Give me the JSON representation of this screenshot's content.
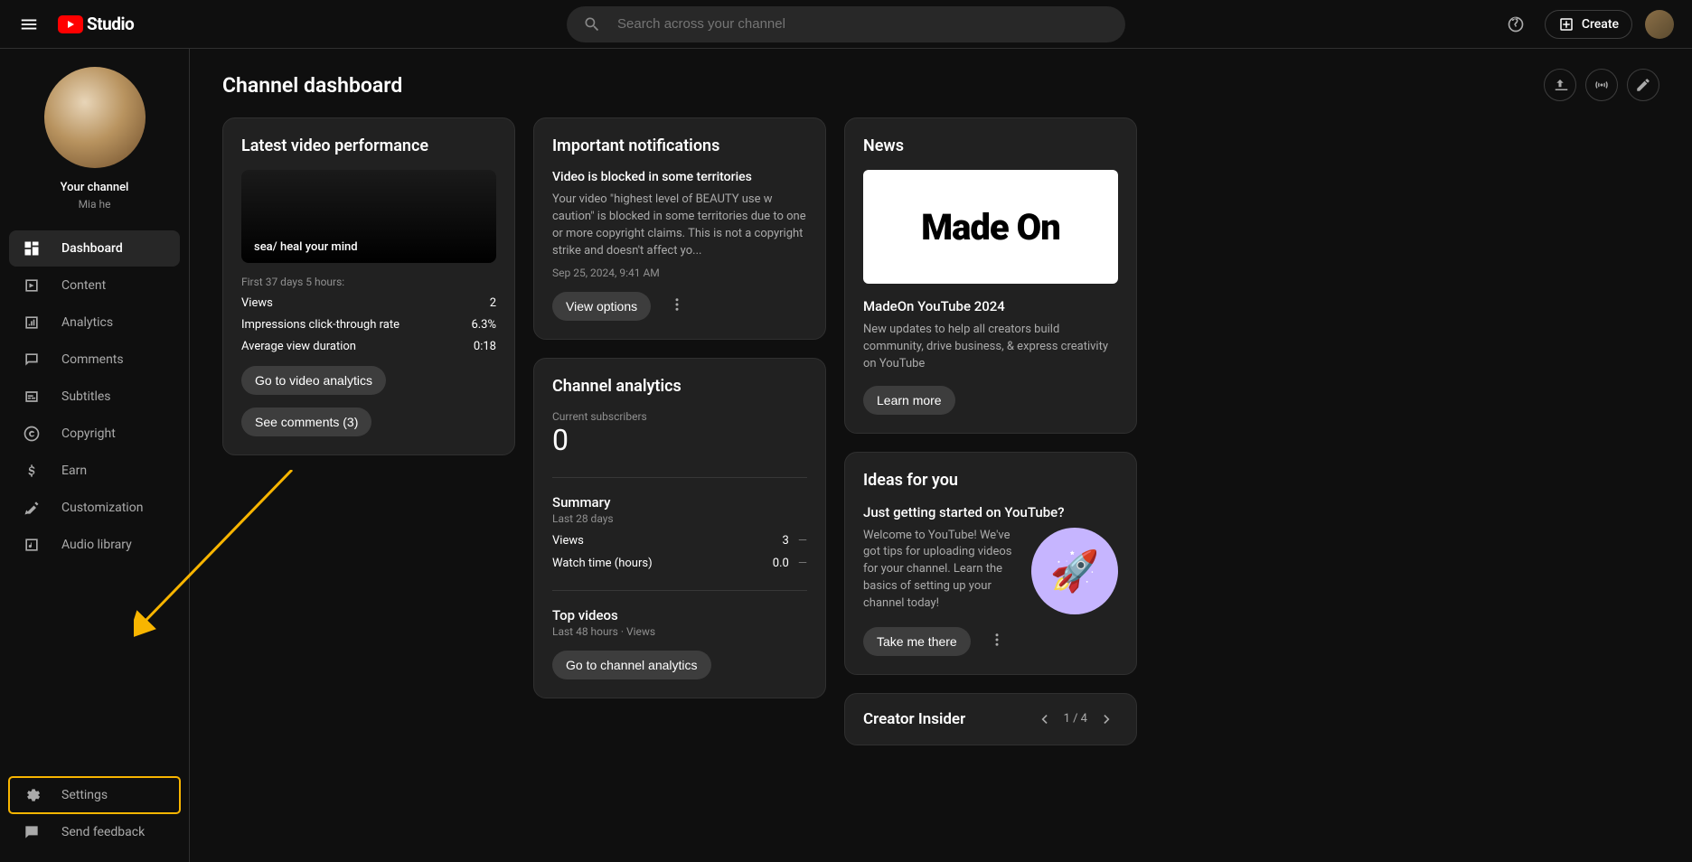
{
  "header": {
    "brand": "Studio",
    "search_placeholder": "Search across your channel",
    "create_label": "Create"
  },
  "sidebar": {
    "channel_label": "Your channel",
    "channel_name": "Mia he",
    "items": [
      {
        "label": "Dashboard"
      },
      {
        "label": "Content"
      },
      {
        "label": "Analytics"
      },
      {
        "label": "Comments"
      },
      {
        "label": "Subtitles"
      },
      {
        "label": "Copyright"
      },
      {
        "label": "Earn"
      },
      {
        "label": "Customization"
      },
      {
        "label": "Audio library"
      }
    ],
    "footer": [
      {
        "label": "Settings"
      },
      {
        "label": "Send feedback"
      }
    ]
  },
  "page": {
    "title": "Channel dashboard"
  },
  "latest_video": {
    "card_title": "Latest video performance",
    "thumbnail_text": "sea/ heal your mind",
    "period": "First 37 days 5 hours:",
    "stats": [
      {
        "label": "Views",
        "value": "2"
      },
      {
        "label": "Impressions click-through rate",
        "value": "6.3%"
      },
      {
        "label": "Average view duration",
        "value": "0:18"
      }
    ],
    "btn_analytics": "Go to video analytics",
    "btn_comments": "See comments (3)"
  },
  "notifications": {
    "card_title": "Important notifications",
    "title": "Video is blocked in some territories",
    "text": "Your video \"highest level of BEAUTY use w caution\" is blocked in some territories due to one or more copyright claims. This is not a copyright strike and doesn't affect yo...",
    "date": "Sep 25, 2024, 9:41 AM",
    "btn": "View options"
  },
  "analytics": {
    "card_title": "Channel analytics",
    "subs_label": "Current subscribers",
    "subs_value": "0",
    "summary_title": "Summary",
    "summary_sub": "Last 28 days",
    "rows": [
      {
        "label": "Views",
        "value": "3"
      },
      {
        "label": "Watch time (hours)",
        "value": "0.0"
      }
    ],
    "top_title": "Top videos",
    "top_sub": "Last 48 hours · Views",
    "btn": "Go to channel analytics"
  },
  "news": {
    "card_title": "News",
    "image_text": "Made On",
    "headline": "MadeOn YouTube 2024",
    "desc": "New updates to help all creators build community, drive business, & express creativity on YouTube",
    "btn": "Learn more"
  },
  "ideas": {
    "card_title": "Ideas for you",
    "headline": "Just getting started on YouTube?",
    "desc": "Welcome to YouTube! We've got tips for uploading videos for your channel. Learn the basics of setting up your channel today!",
    "btn": "Take me there"
  },
  "insider": {
    "card_title": "Creator Insider",
    "pager": "1 / 4"
  }
}
